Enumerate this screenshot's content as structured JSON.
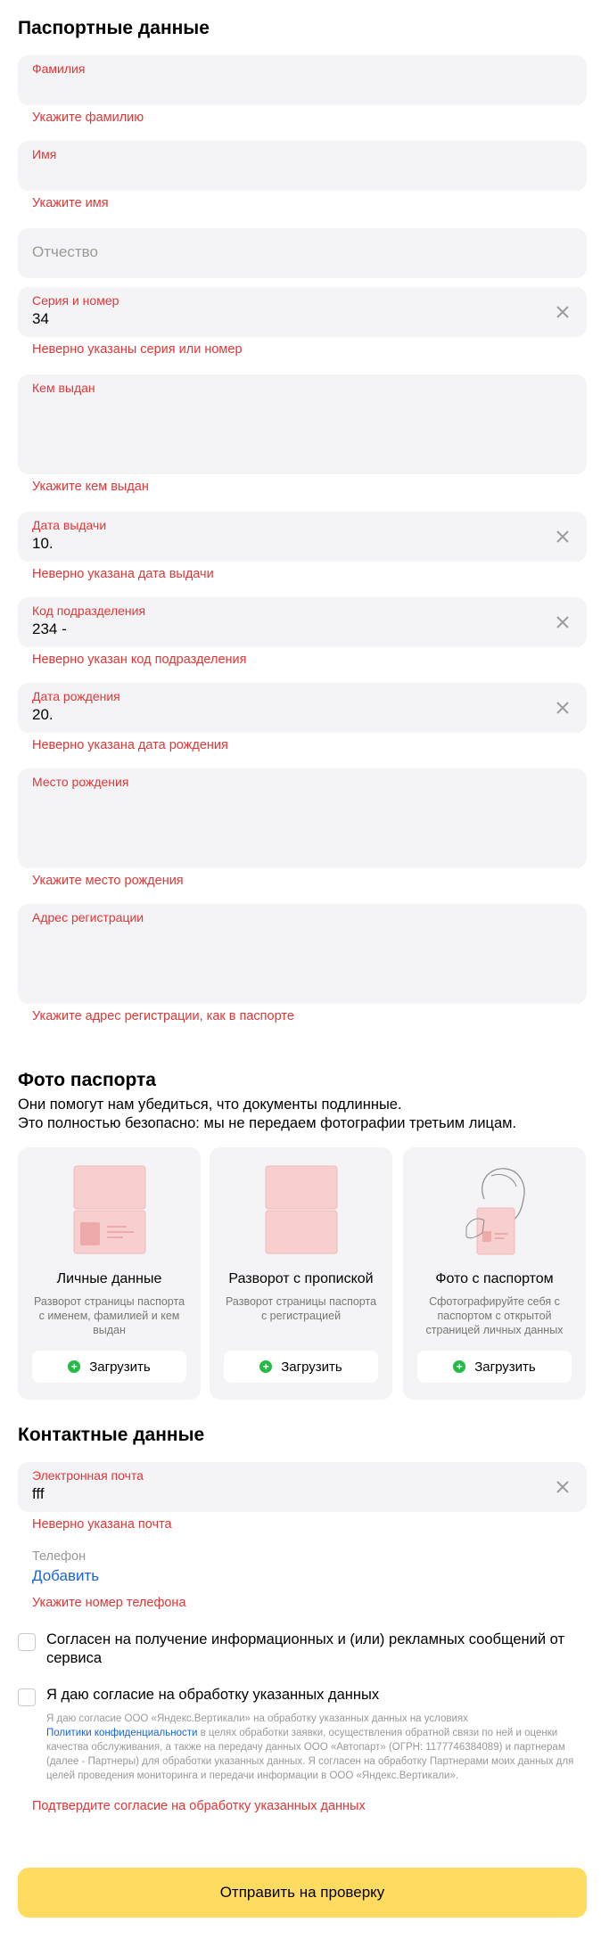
{
  "passport": {
    "title": "Паспортные данные",
    "lastname": {
      "label": "Фамилия",
      "error": "Укажите фамилию"
    },
    "firstname": {
      "label": "Имя",
      "error": "Укажите имя"
    },
    "middlename": {
      "placeholder": "Отчество"
    },
    "series": {
      "label": "Серия и номер",
      "value": "34",
      "error": "Неверно указаны серия или номер"
    },
    "issued_by": {
      "label": "Кем выдан",
      "error": "Укажите кем выдан"
    },
    "issue_date": {
      "label": "Дата выдачи",
      "value": "10.",
      "error": "Неверно указана дата выдачи"
    },
    "dept_code": {
      "label": "Код подразделения",
      "value": "234 -",
      "error": "Неверно указан код подразделения"
    },
    "birth_date": {
      "label": "Дата рождения",
      "value": "20.",
      "error": "Неверно указана дата рождения"
    },
    "birth_place": {
      "label": "Место рождения",
      "error": "Укажите место рождения"
    },
    "reg_address": {
      "label": "Адрес регистрации",
      "error": "Укажите адрес регистрации, как в паспорте"
    }
  },
  "photos": {
    "title": "Фото паспорта",
    "line1": "Они помогут нам убедиться, что документы подлинные.",
    "line2": "Это полностью безопасно: мы не передаем фотографии третьим лицам.",
    "cards": [
      {
        "title": "Личные данные",
        "desc": "Разворот страницы паспорта с именем, фамилией и кем выдан",
        "button": "Загрузить",
        "icon": "passport-personal-icon"
      },
      {
        "title": "Разворот с пропиской",
        "desc": "Разворот страницы паспорта с регистрацией",
        "button": "Загрузить",
        "icon": "passport-registration-icon"
      },
      {
        "title": "Фото с паспортом",
        "desc": "Сфотографируйте себя с паспортом с открытой страницей личных данных",
        "button": "Загрузить",
        "icon": "selfie-with-passport-icon"
      }
    ]
  },
  "contacts": {
    "title": "Контактные данные",
    "email": {
      "label": "Электронная почта",
      "value": "fff",
      "error": "Неверно указана почта"
    },
    "phone": {
      "label": "Телефон",
      "add": "Добавить",
      "error": "Укажите номер телефона"
    },
    "consent_ads": "Согласен на получение информационных и (или) рекламных сообщений от сервиса",
    "consent_data": "Я даю согласие на обработку указанных данных",
    "legal_1": "Я даю согласие ООО «Яндекс.Вертикали» на обработку указанных данных на условиях",
    "legal_link": "Политики конфиденциальности",
    "legal_2": " в целях обработки заявки, осуществления обратной связи по ней и оценки качества обслуживания, а также на передачу данных ООО «Автопарт» (ОГРН: 1177746384089) и партнерам (далее - Партнеры) для обработки указанных данных. Я согласен на обработку Партнерами моих данных для целей проведения мониторинга и передачи информации в ООО «Яндекс.Вертикали».",
    "consent_error": "Подтвердите согласие на обработку указанных данных"
  },
  "submit_label": "Отправить на проверку",
  "colors": {
    "error": "#e23636",
    "field_bg": "#f4f4f6",
    "accent": "#ffdc60",
    "link": "#1b63d8",
    "success": "#22bb44"
  }
}
